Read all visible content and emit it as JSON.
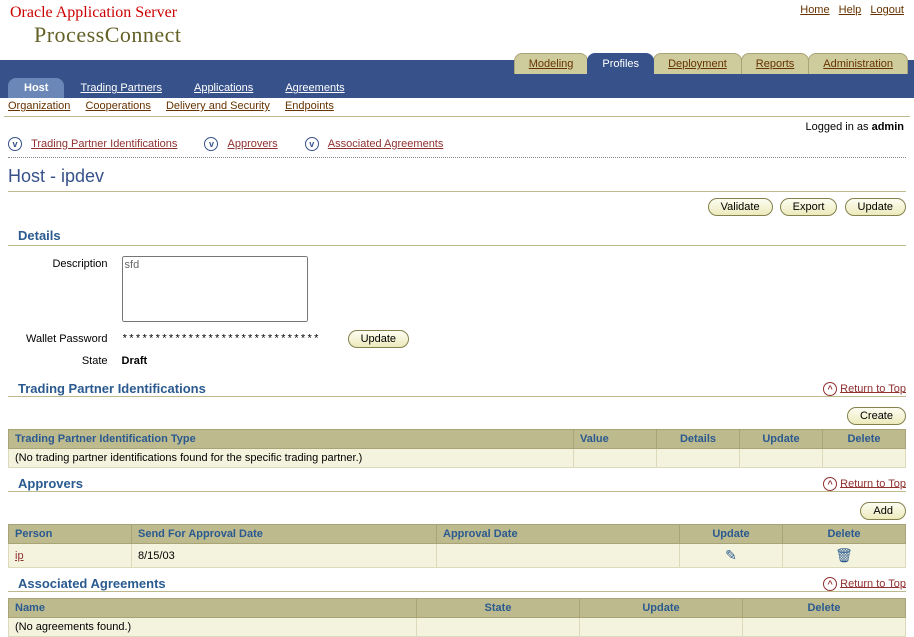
{
  "header": {
    "brand_line1": "Oracle Application Server",
    "brand_line2": "ProcessConnect",
    "links": {
      "home": "Home",
      "help": "Help",
      "logout": "Logout"
    }
  },
  "main_tabs": {
    "modeling": "Modeling",
    "profiles": "Profiles",
    "deployment": "Deployment",
    "reports": "Reports",
    "administration": "Administration"
  },
  "sub_tabs": {
    "host": "Host",
    "trading_partners": "Trading Partners",
    "applications": "Applications",
    "agreements": "Agreements"
  },
  "subsub": {
    "organization": "Organization",
    "cooperations": "Cooperations",
    "delivery": "Delivery and Security",
    "endpoints": "Endpoints"
  },
  "login": {
    "prefix": "Logged in as ",
    "user": "admin"
  },
  "anchors": {
    "tpi": "Trading Partner Identifications",
    "approvers": "Approvers",
    "assoc": "Associated Agreements"
  },
  "page_title": "Host - ipdev",
  "buttons": {
    "validate": "Validate",
    "export": "Export",
    "update": "Update",
    "create": "Create",
    "add": "Add"
  },
  "details": {
    "section": "Details",
    "description_label": "Description",
    "description_value": "sfd",
    "wallet_label": "Wallet Password",
    "wallet_value": "******************************",
    "state_label": "State",
    "state_value": "Draft",
    "update_btn": "Update"
  },
  "return_to_top": "Return to Top",
  "tpi_section": {
    "title": "Trading Partner Identifications",
    "cols": {
      "type": "Trading Partner Identification Type",
      "value": "Value",
      "details": "Details",
      "update": "Update",
      "delete": "Delete"
    },
    "empty": "(No trading partner identifications found for the specific trading partner.)"
  },
  "approvers_section": {
    "title": "Approvers",
    "cols": {
      "person": "Person",
      "sent": "Send For Approval Date",
      "approval": "Approval Date",
      "update": "Update",
      "delete": "Delete"
    },
    "rows": [
      {
        "person": "ip",
        "sent": "8/15/03",
        "approval": ""
      }
    ]
  },
  "assoc_section": {
    "title": "Associated Agreements",
    "cols": {
      "name": "Name",
      "state": "State",
      "update": "Update",
      "delete": "Delete"
    },
    "empty": "(No agreements found.)"
  }
}
